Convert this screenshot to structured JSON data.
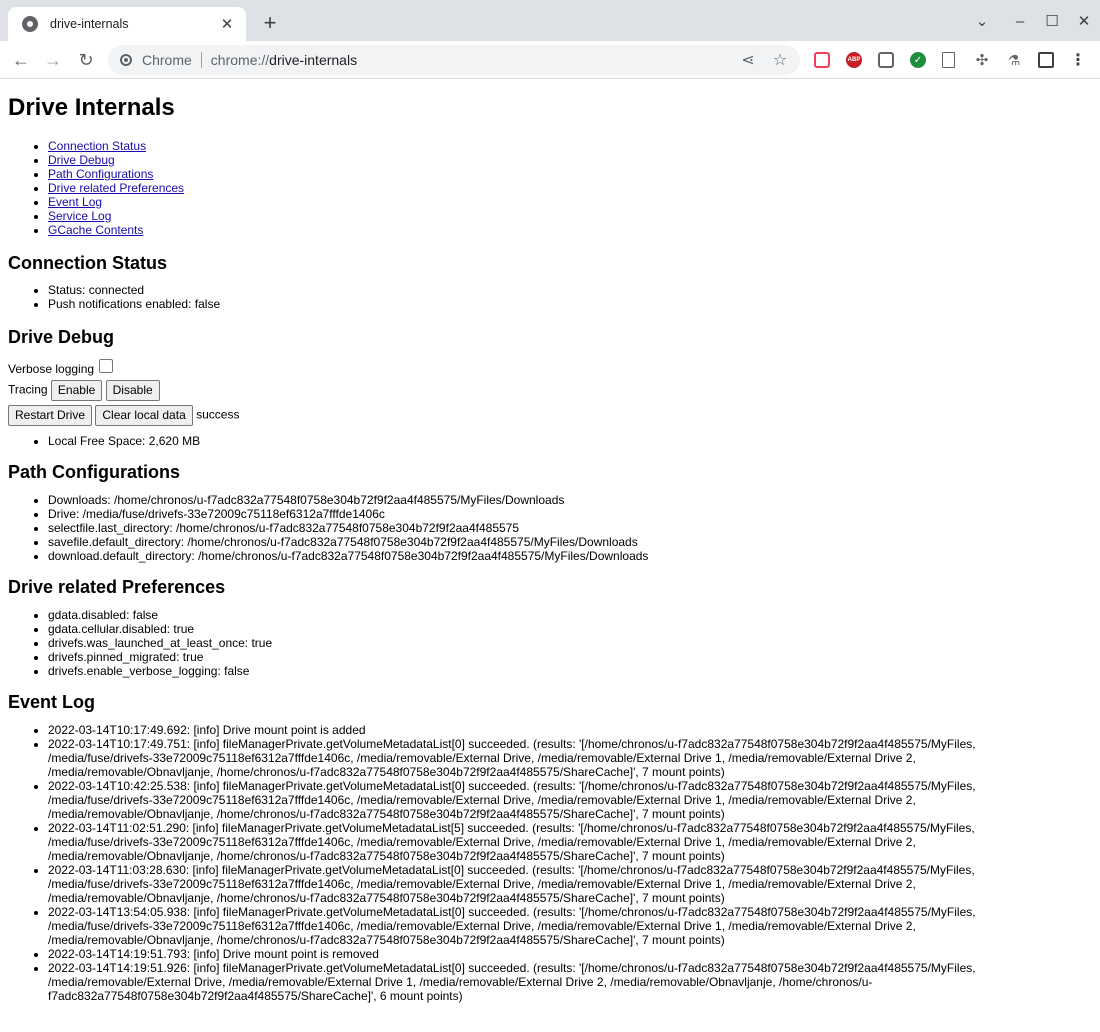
{
  "browser": {
    "tab_title": "drive-internals",
    "omnibox_label": "Chrome",
    "url_scheme": "chrome://",
    "url_host": "drive-internals",
    "extensions": [
      {
        "name": "pocket-icon",
        "color": "#ef4056"
      },
      {
        "name": "adblock-icon",
        "color": "#c41e27",
        "text": "ABP"
      },
      {
        "name": "bitwarden-icon",
        "color": "#5f6368"
      },
      {
        "name": "check-extension-icon",
        "color": "#1e8e3e"
      },
      {
        "name": "document-extension-icon",
        "color": "#5f6368"
      },
      {
        "name": "puzzle-icon",
        "color": "#5f6368"
      },
      {
        "name": "flask-icon",
        "color": "#5f6368"
      }
    ]
  },
  "page": {
    "title": "Drive Internals",
    "toc": [
      "Connection Status",
      "Drive Debug",
      "Path Configurations",
      "Drive related Preferences",
      "Event Log",
      "Service Log",
      "GCache Contents"
    ],
    "connection_status": {
      "heading": "Connection Status",
      "items": [
        "Status: connected",
        "Push notifications enabled: false"
      ]
    },
    "drive_debug": {
      "heading": "Drive Debug",
      "verbose_label": "Verbose logging",
      "tracing_label": "Tracing",
      "enable_label": "Enable",
      "disable_label": "Disable",
      "restart_label": "Restart Drive",
      "clear_label": "Clear local data",
      "clear_status": "success",
      "items": [
        "Local Free Space: 2,620 MB"
      ]
    },
    "path_configurations": {
      "heading": "Path Configurations",
      "items": [
        "Downloads: /home/chronos/u-f7adc832a77548f0758e304b72f9f2aa4f485575/MyFiles/Downloads",
        "Drive: /media/fuse/drivefs-33e72009c75118ef6312a7fffde1406c",
        "selectfile.last_directory: /home/chronos/u-f7adc832a77548f0758e304b72f9f2aa4f485575",
        "savefile.default_directory: /home/chronos/u-f7adc832a77548f0758e304b72f9f2aa4f485575/MyFiles/Downloads",
        "download.default_directory: /home/chronos/u-f7adc832a77548f0758e304b72f9f2aa4f485575/MyFiles/Downloads"
      ]
    },
    "preferences": {
      "heading": "Drive related Preferences",
      "items": [
        "gdata.disabled: false",
        "gdata.cellular.disabled: true",
        "drivefs.was_launched_at_least_once: true",
        "drivefs.pinned_migrated: true",
        "drivefs.enable_verbose_logging: false"
      ]
    },
    "event_log": {
      "heading": "Event Log",
      "entries": [
        {
          "lines": [
            "2022-03-14T10:17:49.692: [info] Drive mount point is added"
          ]
        },
        {
          "lines": [
            "2022-03-14T10:17:49.751: [info] fileManagerPrivate.getVolumeMetadataList[0] succeeded. (results: '[/home/chronos/u-f7adc832a77548f0758e304b72f9f2aa4f485575/MyFiles,",
            "/media/fuse/drivefs-33e72009c75118ef6312a7fffde1406c, /media/removable/External Drive, /media/removable/External Drive 1, /media/removable/External Drive 2,",
            "/media/removable/Obnavljanje, /home/chronos/u-f7adc832a77548f0758e304b72f9f2aa4f485575/ShareCache]', 7 mount points)"
          ]
        },
        {
          "lines": [
            "2022-03-14T10:42:25.538: [info] fileManagerPrivate.getVolumeMetadataList[0] succeeded. (results: '[/home/chronos/u-f7adc832a77548f0758e304b72f9f2aa4f485575/MyFiles,",
            "/media/fuse/drivefs-33e72009c75118ef6312a7fffde1406c, /media/removable/External Drive, /media/removable/External Drive 1, /media/removable/External Drive 2,",
            "/media/removable/Obnavljanje, /home/chronos/u-f7adc832a77548f0758e304b72f9f2aa4f485575/ShareCache]', 7 mount points)"
          ]
        },
        {
          "lines": [
            "2022-03-14T11:02:51.290: [info] fileManagerPrivate.getVolumeMetadataList[5] succeeded. (results: '[/home/chronos/u-f7adc832a77548f0758e304b72f9f2aa4f485575/MyFiles,",
            "/media/fuse/drivefs-33e72009c75118ef6312a7fffde1406c, /media/removable/External Drive, /media/removable/External Drive 1, /media/removable/External Drive 2,",
            "/media/removable/Obnavljanje, /home/chronos/u-f7adc832a77548f0758e304b72f9f2aa4f485575/ShareCache]', 7 mount points)"
          ]
        },
        {
          "lines": [
            "2022-03-14T11:03:28.630: [info] fileManagerPrivate.getVolumeMetadataList[0] succeeded. (results: '[/home/chronos/u-f7adc832a77548f0758e304b72f9f2aa4f485575/MyFiles,",
            "/media/fuse/drivefs-33e72009c75118ef6312a7fffde1406c, /media/removable/External Drive, /media/removable/External Drive 1, /media/removable/External Drive 2,",
            "/media/removable/Obnavljanje, /home/chronos/u-f7adc832a77548f0758e304b72f9f2aa4f485575/ShareCache]', 7 mount points)"
          ]
        },
        {
          "lines": [
            "2022-03-14T13:54:05.938: [info] fileManagerPrivate.getVolumeMetadataList[0] succeeded. (results: '[/home/chronos/u-f7adc832a77548f0758e304b72f9f2aa4f485575/MyFiles,",
            "/media/fuse/drivefs-33e72009c75118ef6312a7fffde1406c, /media/removable/External Drive, /media/removable/External Drive 1, /media/removable/External Drive 2,",
            "/media/removable/Obnavljanje, /home/chronos/u-f7adc832a77548f0758e304b72f9f2aa4f485575/ShareCache]', 7 mount points)"
          ]
        },
        {
          "lines": [
            "2022-03-14T14:19:51.793: [info] Drive mount point is removed"
          ]
        },
        {
          "lines": [
            "2022-03-14T14:19:51.926: [info] fileManagerPrivate.getVolumeMetadataList[0] succeeded. (results: '[/home/chronos/u-f7adc832a77548f0758e304b72f9f2aa4f485575/MyFiles,",
            "/media/removable/External Drive, /media/removable/External Drive 1, /media/removable/External Drive 2, /media/removable/Obnavljanje, /home/chronos/u-",
            "f7adc832a77548f0758e304b72f9f2aa4f485575/ShareCache]', 6 mount points)"
          ]
        }
      ]
    }
  }
}
